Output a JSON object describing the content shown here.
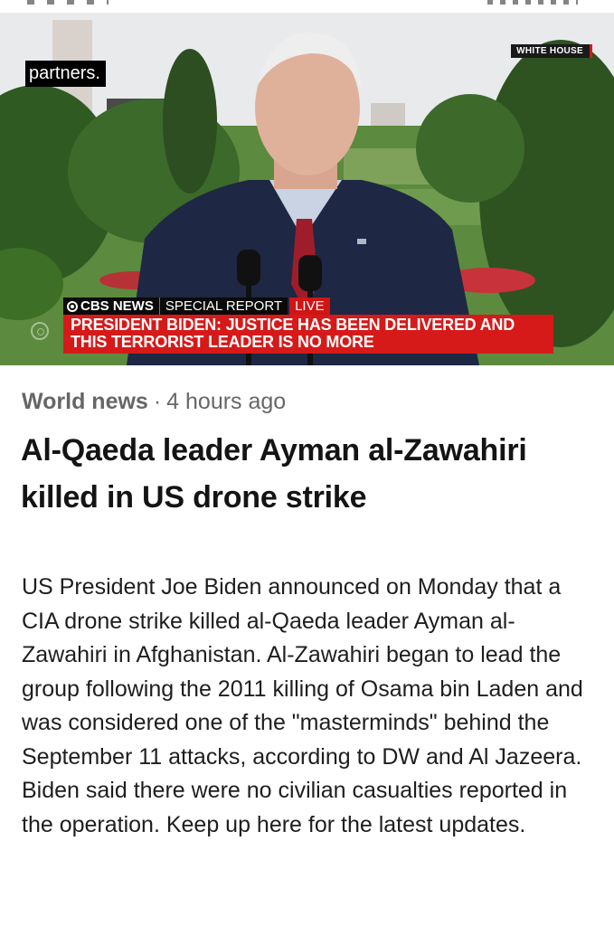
{
  "hero": {
    "watermark": "partners.",
    "location_badge": "WHITE HOUSE",
    "broadcast": {
      "network": "CBS NEWS",
      "segment": "SPECIAL REPORT",
      "status": "LIVE",
      "headline": "PRESIDENT BIDEN: JUSTICE HAS BEEN DELIVERED AND THIS TERRORIST LEADER IS NO MORE"
    }
  },
  "article": {
    "category": "World news",
    "separator": "·",
    "time": "4 hours ago",
    "title": "Al-Qaeda leader Ayman al-Zawahiri killed in US drone strike",
    "body": "US President Joe Biden announced on Monday that a CIA drone strike killed al-Qaeda leader Ayman al-Zawahiri in Afghanistan. Al-Zawahiri began to lead the group following the 2011 killing of Osama bin Laden and was considered one of the \"masterminds\" behind the September 11 attacks, according to DW and Al Jazeera. Biden said there were no civilian casualties reported in the operation. Keep up here for the latest updates."
  },
  "colors": {
    "lower_third_red": "#d61919",
    "headline_text": "#141414",
    "meta_text": "#676767"
  }
}
